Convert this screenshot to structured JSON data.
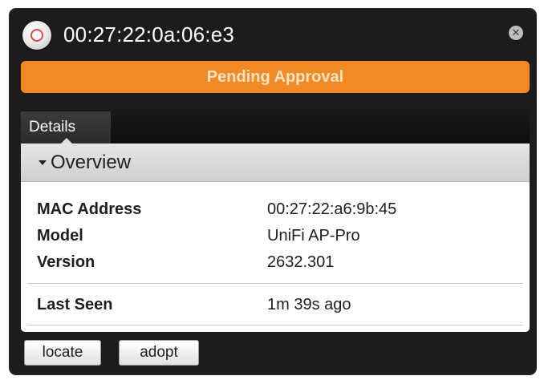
{
  "window": {
    "title": "00:27:22:0a:06:e3",
    "close_icon": "close-icon"
  },
  "status": {
    "label": "Pending Approval",
    "color": "#f08a24"
  },
  "tabs": [
    {
      "label": "Details",
      "active": true
    }
  ],
  "overview": {
    "title": "Overview",
    "rows": [
      {
        "label": "MAC Address",
        "value": "00:27:22:a6:9b:45"
      },
      {
        "label": "Model",
        "value": "UniFi AP-Pro"
      },
      {
        "label": "Version",
        "value": "2632.301"
      }
    ],
    "last_seen": {
      "label": "Last Seen",
      "value": "1m 39s ago"
    }
  },
  "buttons": {
    "locate": "locate",
    "adopt": "adopt"
  }
}
